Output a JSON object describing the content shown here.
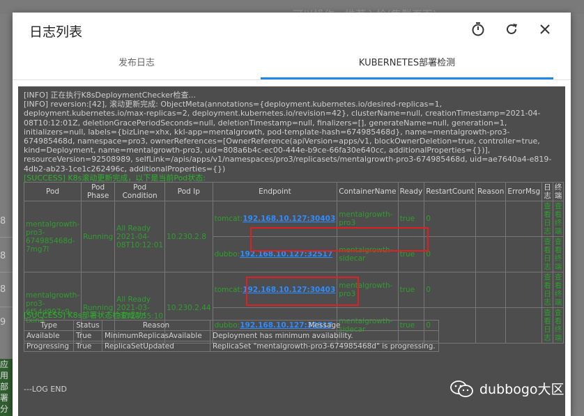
{
  "background": {
    "top_text": "可以操作，推荐入检(集群页面)",
    "row_numbers": [
      "8",
      "8",
      "8",
      "9"
    ],
    "left_block_text": "应用 部署 分支 配置 去初"
  },
  "modal": {
    "title": "日志列表",
    "icons": [
      "timer-icon",
      "refresh-icon",
      "close-icon"
    ],
    "tabs": [
      {
        "label": "发布日志",
        "active": false
      },
      {
        "label": "KUBERNETES部署检测",
        "active": true
      }
    ]
  },
  "log": {
    "lines": [
      "[INFO]   正在执行K8sDeploymentChecker检查...",
      "[INFO]   reversion:[42], 滚动更新完成: ObjectMeta(annotations={deployment.kubernetes.io/desired-replicas=1, deployment.kubernetes.io/max-replicas=2, deployment.kubernetes.io/revision=42}, clusterName=null, creationTimestamp=2021-04-08T10:12:01Z, deletionGracePeriodSeconds=null, deletionTimestamp=null, finalizers=[], generateName=null, generation=1, initializers=null, labels={bizLine=xhx, kkl-app=mentalgrowth, pod-template-hash=674985468d}, name=mentalgrowth-pro3-674985468d, namespace=pro3, ownerReferences=[OwnerReference(apiVersion=apps/v1, blockOwnerDeletion=true, controller=true, kind=Deployment, name=mentalgrowth-pro3, uid=808a6b4c-ec00-444e-b9ce-66fa30e640cc, additionalProperties={})], resourceVersion=92508989, selfLink=/apis/apps/v1/namespaces/pro3/replicasets/mentalgrowth-pro3-674985468d, uid=ae7640a4-e819-4db2-ab23-1ce1c262496c, additionalProperties={})"
    ],
    "success1": "[SUCCESS]   K8s滚动更新完成，以下是当前Pod状态:",
    "success2": "[SUCCESS]   K8s部署状态检查成功!",
    "end": "---LOG END"
  },
  "pod_table": {
    "headers": [
      "Pod",
      "Pod Phase",
      "Pod Condition",
      "Pod Ip",
      "Endpoint",
      "ContainerName",
      "Ready",
      "RestartCount",
      "Reason",
      "ErrorMsg",
      "日志",
      "终端"
    ],
    "rows": [
      {
        "pod": "mentalgrowth-pro3-674985468d-7mg7l",
        "phase": "Running",
        "condition": "All Ready 2021-04-08T10:12:01",
        "ip": "10.230.2.8",
        "endpoints": [
          {
            "label": "tomcat:",
            "link": "192.168.10.127:30403",
            "container": "mentalgrowth-pro3",
            "ready": "true",
            "restart": "0",
            "log": "查看日志",
            "term": "查看终端"
          },
          {
            "label": "dubbo:",
            "link": "192.168.10.127:32517",
            "container": "mentalgrowth-sidecar",
            "ready": "true",
            "restart": "0",
            "log": "查看日志",
            "term": "查看终端"
          }
        ]
      },
      {
        "pod": "mentalgrowth-pro3-6f54d997c9-txln4",
        "phase": "Running",
        "condition": "All Ready 2021-03-31T20:55:10",
        "ip": "10.230.2.44",
        "endpoints": [
          {
            "label": "tomcat:",
            "link": "192.168.10.127:30403",
            "container": "mentalgrowth-pro3",
            "ready": "true",
            "restart": "0",
            "log": "查看日志",
            "term": "查看终端"
          },
          {
            "label": "dubbo:",
            "link": "192.168.10.127:32517",
            "container": "mentalgrowth-sidecar",
            "ready": "true",
            "restart": "0",
            "log": "查看日志",
            "term": "查看终端"
          }
        ]
      }
    ]
  },
  "cond_table": {
    "headers": [
      "Type",
      "Status",
      "Reason",
      "Message"
    ],
    "rows": [
      [
        "Available",
        "True",
        "MinimumReplicasAvailable",
        "Deployment has minimum availability."
      ],
      [
        "Progressing",
        "True",
        "ReplicaSetUpdated",
        "ReplicaSet \"mentalgrowth-pro3-674985468d\" is progressing."
      ]
    ]
  },
  "watermark": {
    "text": "dubbogo大区",
    "icon": "wechat-icon"
  },
  "colors": {
    "success": "#2bb32b",
    "link": "#2f8cff",
    "highlight": "#e02020",
    "tab_accent": "#1e88e5"
  }
}
